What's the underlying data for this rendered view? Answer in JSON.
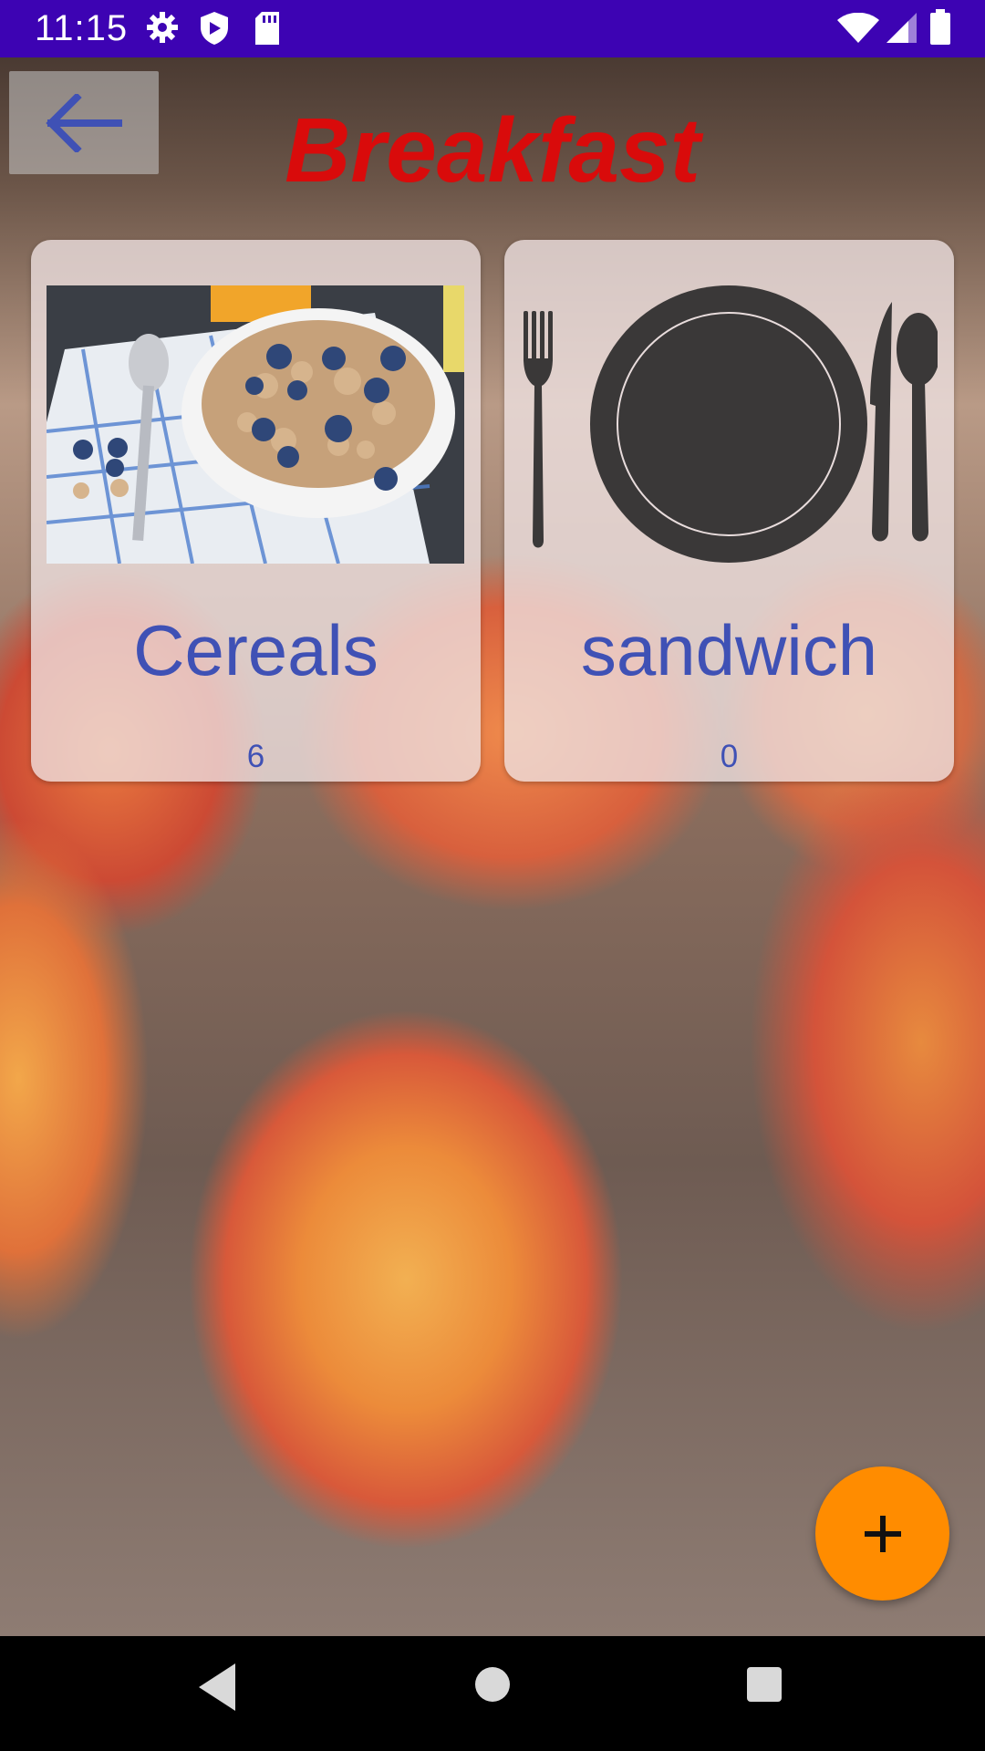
{
  "status_bar": {
    "time": "11:15",
    "icons": [
      "settings-icon",
      "shield-icon",
      "sd-card-icon",
      "wifi-icon",
      "signal-icon",
      "battery-icon"
    ]
  },
  "header": {
    "title": "Breakfast",
    "title_color": "#d90b0b",
    "back_icon": "arrow-left-icon"
  },
  "cards": [
    {
      "title": "Cereals",
      "count": "6",
      "image": "cereal-bowl-photo"
    },
    {
      "title": "sandwich",
      "count": "0",
      "image": "plate-cutlery-icon"
    }
  ],
  "fab": {
    "icon": "plus-icon",
    "color": "#ff8c00"
  },
  "nav_bar": {
    "buttons": [
      "back-triangle-icon",
      "home-circle-icon",
      "recents-square-icon"
    ]
  },
  "colors": {
    "status_bar": "#3d03b3",
    "card_text": "#3f51b5",
    "accent": "#ff8c00"
  }
}
